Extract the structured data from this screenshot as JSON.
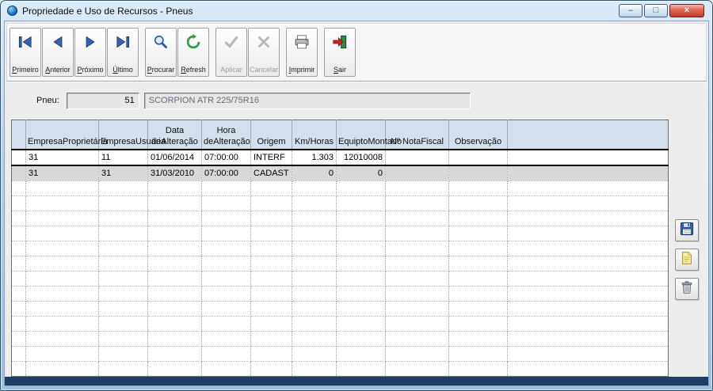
{
  "window": {
    "title": "Propriedade e Uso de Recursos - Pneus",
    "controls": {
      "minimize": "–",
      "maximize": "□",
      "close": "×"
    }
  },
  "toolbar": {
    "buttons": [
      {
        "label": "Primeiro",
        "icon": "first-record-icon",
        "enabled": true
      },
      {
        "label": "Anterior",
        "icon": "previous-record-icon",
        "enabled": true
      },
      {
        "label": "Próximo",
        "icon": "next-record-icon",
        "enabled": true
      },
      {
        "label": "Último",
        "icon": "last-record-icon",
        "enabled": true
      },
      {
        "label": "Procurar",
        "icon": "search-icon",
        "enabled": true
      },
      {
        "label": "Refresh",
        "icon": "refresh-icon",
        "enabled": true
      },
      {
        "label": "Aplicar",
        "icon": "apply-icon",
        "enabled": false
      },
      {
        "label": "Cancelar",
        "icon": "cancel-icon",
        "enabled": false
      },
      {
        "label": "Imprimir",
        "icon": "print-icon",
        "enabled": true
      },
      {
        "label": "Sair",
        "icon": "exit-icon",
        "enabled": true
      }
    ]
  },
  "form": {
    "pneu_label": "Pneu:",
    "pneu_value": "51",
    "pneu_description": "SCORPION ATR 225/75R16"
  },
  "grid": {
    "columns": [
      {
        "lines": [
          "Empresa",
          "Proprietária"
        ]
      },
      {
        "lines": [
          "Empresa",
          "Usuária"
        ]
      },
      {
        "lines": [
          "Data de",
          "Alteração"
        ]
      },
      {
        "lines": [
          "Hora de",
          "Alteração"
        ]
      },
      {
        "lines": [
          "",
          "Origem"
        ]
      },
      {
        "lines": [
          "",
          "Km/Horas"
        ]
      },
      {
        "lines": [
          "Equipto",
          "Montado"
        ]
      },
      {
        "lines": [
          "Nº Nota",
          "Fiscal"
        ]
      },
      {
        "lines": [
          "",
          "Observação"
        ]
      }
    ],
    "rows": [
      [
        "31",
        "11",
        "01/06/2014",
        "07:00:00",
        "INTERF",
        "1.303",
        "12010008",
        "",
        ""
      ],
      [
        "31",
        "31",
        "31/03/2010",
        "07:00:00",
        "CADAST",
        "0",
        "0",
        "",
        ""
      ]
    ],
    "current_row_index": 0,
    "shaded_row_indexes": [
      1
    ],
    "empty_row_count": 13
  },
  "side_buttons": [
    {
      "name": "save",
      "icon": "floppy-icon"
    },
    {
      "name": "new",
      "icon": "note-icon"
    },
    {
      "name": "delete",
      "icon": "trash-icon"
    }
  ]
}
